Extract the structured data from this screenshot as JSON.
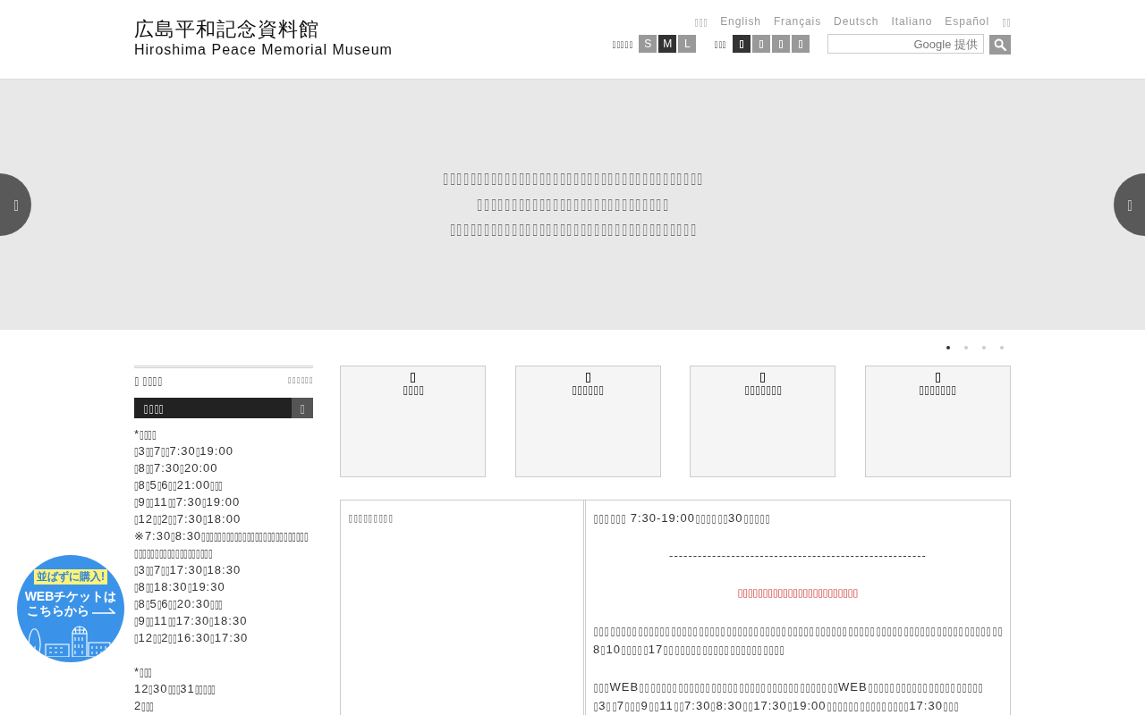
{
  "header": {
    "logo": {
      "title": "広島平和記念資料館",
      "subtitle": "Hiroshima Peace Memorial Museum"
    },
    "languages": [
      "▯▯▯",
      "English",
      "Français",
      "Deutsch",
      "Italiano",
      "Español",
      "▯▯"
    ],
    "text_size": {
      "label": "▯▯▯▯▯",
      "options": [
        {
          "label": "S",
          "selected": false
        },
        {
          "label": "M",
          "selected": true
        },
        {
          "label": "L",
          "selected": false
        }
      ]
    },
    "background_color": {
      "label": "▯▯▯",
      "options": [
        {
          "selected": true
        },
        {
          "selected": false
        },
        {
          "selected": false
        },
        {
          "selected": false
        }
      ]
    },
    "search": {
      "placeholder": "Google 提供"
    }
  },
  "hero": {
    "lines": [
      "▯▯▯▯▯▯▯▯▯▯▯▯▯▯▯▯▯▯▯▯▯▯▯▯▯▯▯▯▯▯▯▯▯▯▯▯▯▯",
      "▯▯▯▯▯▯▯▯▯▯▯▯▯▯▯▯▯▯▯▯▯▯▯▯▯▯▯▯",
      "▯▯▯▯▯▯▯▯▯▯▯▯▯▯▯▯▯▯▯▯▯▯▯▯▯▯▯▯▯▯▯▯▯▯▯▯"
    ],
    "prev_button": "▯",
    "next_button": "▯"
  },
  "slider_dots": [
    {
      "selected": true
    },
    {
      "selected": false
    },
    {
      "selected": false
    },
    {
      "selected": false
    }
  ],
  "sidebar": {
    "title": "▯ ▯▯▯▯",
    "link": "▯▯▯▯▯▯",
    "bar": {
      "title": "▯▯▯▯",
      "button": "▯"
    },
    "sections": [
      {
        "lines": [
          "*▯▯▯▯",
          "▯3▯▯7▯▯7:30▯19:00",
          "▯8▯▯7:30▯20:00",
          "▯8▯5▯6▯▯21:00▯▯▯",
          "▯9▯▯11▯▯7:30▯19:00",
          "▯12▯▯2▯▯7:30▯18:00",
          "※7:30▯8:30▯▯▯▯▯▯▯▯▯▯▯▯▯▯▯▯▯▯▯▯▯▯▯▯▯▯",
          "▯▯▯▯▯▯▯▯▯▯▯▯▯▯▯▯▯▯▯",
          "▯3▯▯7▯▯17:30▯18:30",
          "▯8▯▯18:30▯19:30",
          "▯8▯5▯6▯▯20:30▯▯▯",
          "▯9▯▯11▯▯17:30▯18:30",
          "▯12▯▯2▯▯16:30▯17:30"
        ]
      },
      {
        "lines": [
          "*▯▯▯",
          "12▯30▯▯▯31▯▯▯▯▯",
          "2▯▯▯"
        ]
      }
    ]
  },
  "cards": [
    {
      "label": "▯▯▯▯"
    },
    {
      "label": "▯▯▯▯▯▯"
    },
    {
      "label": "▯▯▯▯▯▯▯"
    },
    {
      "label": "▯▯▯▯▯▯▯"
    }
  ],
  "info_table": {
    "label": "▯▯▯▯▯▯▯▯▯",
    "blocks": [
      {
        "kind": "text",
        "text": "▯▯▯▯▯▯ 7:30-19:00▯▯▯▯▯▯30▯▯▯▯▯"
      },
      {
        "kind": "divider",
        "text": "------------------------------------------------------"
      },
      {
        "kind": "alert",
        "text": "▯▯▯▯▯▯▯▯▯▯▯▯▯▯▯▯▯▯▯▯▯▯▯▯"
      },
      {
        "kind": "paragraph",
        "text": "▯▯▯▯▯▯▯▯▯▯▯▯▯▯▯▯▯▯▯▯▯▯▯▯▯▯▯▯▯▯▯▯▯▯▯▯▯▯▯▯▯▯▯▯▯▯▯▯▯▯▯▯▯▯▯▯▯▯▯▯▯▯▯▯▯▯▯▯▯▯▯▯▯▯8▯10▯▯▯▯▯17▯▯▯▯▯▯▯▯▯▯▯▯▯▯▯▯▯▯▯▯▯▯"
      },
      {
        "kind": "paragraph",
        "lines": [
          "▯▯▯WEB▯▯▯▯▯▯▯▯▯▯▯▯▯▯▯▯▯▯▯▯▯▯▯▯▯▯▯▯▯▯▯▯▯▯▯▯WEB▯▯▯▯▯▯▯▯▯▯▯▯▯▯▯▯▯▯▯▯▯",
          "▯3▯▯7▯▯▯9▯▯11▯▯7:30▯8:30▯▯17:30▯19:00▯▯▯▯▯▯▯▯▯▯▯▯▯▯▯17:30▯▯▯"
        ]
      }
    ]
  },
  "ticket_badge": {
    "tag": "並ばずに購入!",
    "line_1": "WEBチケットは",
    "line_2": "こちらから"
  }
}
